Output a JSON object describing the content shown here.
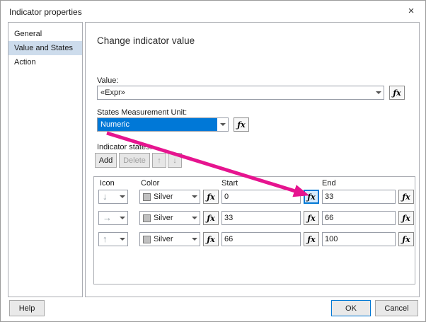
{
  "window": {
    "title": "Indicator properties",
    "close_glyph": "×"
  },
  "icons": {
    "fx": "ƒx",
    "up": "↑",
    "down": "↓"
  },
  "sidebar": {
    "items": [
      {
        "label": "General",
        "selected": false
      },
      {
        "label": "Value and States",
        "selected": true
      },
      {
        "label": "Action",
        "selected": false
      }
    ]
  },
  "main": {
    "heading": "Change indicator value",
    "value_field": {
      "label": "Value:",
      "value": "«Expr»"
    },
    "unit_field": {
      "label": "States Measurement Unit:",
      "value": "Numeric"
    },
    "states": {
      "label": "Indicator states:",
      "toolbar": {
        "add": "Add",
        "delete": "Delete"
      },
      "table": {
        "headers": {
          "icon": "Icon",
          "color": "Color",
          "start": "Start",
          "end": "End"
        },
        "rows": [
          {
            "icon": "down-arrow",
            "glyph": "↓",
            "color": "Silver",
            "start": "0",
            "end": "33",
            "start_fx_highlighted": true
          },
          {
            "icon": "right-arrow",
            "glyph": "→",
            "color": "Silver",
            "start": "33",
            "end": "66",
            "start_fx_highlighted": false
          },
          {
            "icon": "up-arrow",
            "glyph": "↑",
            "color": "Silver",
            "start": "66",
            "end": "100",
            "start_fx_highlighted": false
          }
        ]
      }
    }
  },
  "footer": {
    "help": "Help",
    "ok": "OK",
    "cancel": "Cancel"
  },
  "colors": {
    "accent": "#0078d4",
    "selection": "#0078d7",
    "arrow_annotation": "#e6148f",
    "silver": "#c0c0c0"
  }
}
